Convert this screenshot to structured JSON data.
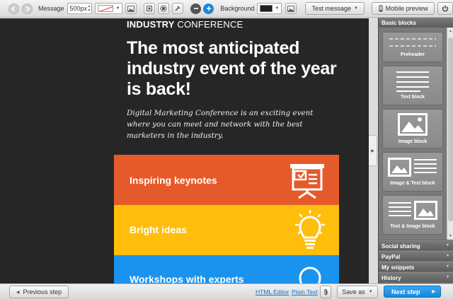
{
  "toolbar": {
    "message_label": "Message",
    "width_value": "500px",
    "background_label": "Background",
    "test_message_label": "Test message",
    "mobile_preview_label": "Mobile preview"
  },
  "email": {
    "conf_bold": "INDUSTRY",
    "conf_rest": "CONFERENCE",
    "headline": "The most anticipated industry event of the year is back!",
    "intro": "Digital Marketing Conference is an exciting event where you can meet and network with the best marketers in the industry.",
    "bands": [
      {
        "label": "Inspiring keynotes",
        "color": "#e55a2b",
        "icon": "presentation-icon"
      },
      {
        "label": "Bright ideas",
        "color": "#ffbe0b",
        "icon": "lightbulb-icon"
      },
      {
        "label": "Workshops with experts",
        "color": "#1a93ee",
        "icon": "lightbulb-outline-icon"
      }
    ]
  },
  "panel": {
    "title": "Basic blocks",
    "blocks": [
      {
        "label": "Preheader",
        "icon": "preheader-icon"
      },
      {
        "label": "Text block",
        "icon": "text-lines-icon"
      },
      {
        "label": "Image block",
        "icon": "image-icon"
      },
      {
        "label": "Image & Text block",
        "icon": "image-text-icon"
      },
      {
        "label": "Text & Image block",
        "icon": "text-image-icon"
      }
    ],
    "sections": [
      "Social sharing",
      "PayPal",
      "My snippets",
      "History"
    ]
  },
  "bottom": {
    "previous_label": "Previous step",
    "html_editor_label": "HTML Editor",
    "plain_text_label": "Plain Text",
    "save_as_label": "Save as",
    "next_label": "Next step"
  },
  "colors": {
    "canvas_bg": "#262626",
    "accent_blue": "#1a88d8",
    "band_orange": "#e55a2b",
    "band_yellow": "#ffbe0b",
    "band_blue": "#1a93ee"
  }
}
